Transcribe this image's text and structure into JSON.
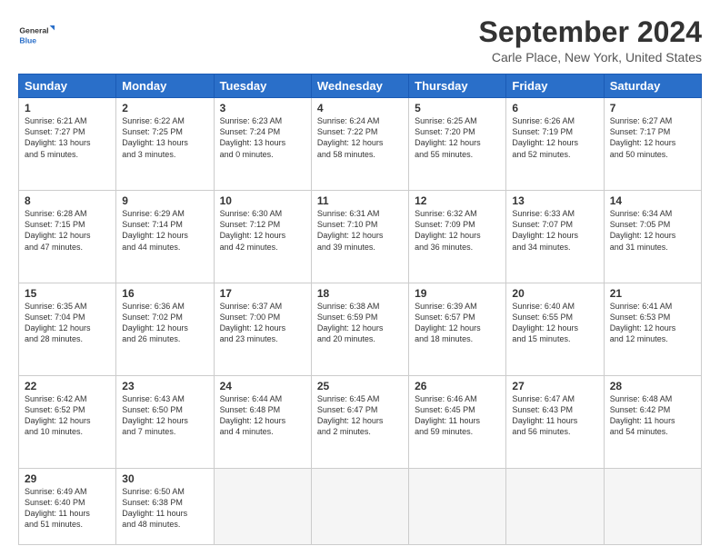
{
  "logo": {
    "line1": "General",
    "line2": "Blue"
  },
  "title": "September 2024",
  "subtitle": "Carle Place, New York, United States",
  "headers": [
    "Sunday",
    "Monday",
    "Tuesday",
    "Wednesday",
    "Thursday",
    "Friday",
    "Saturday"
  ],
  "weeks": [
    [
      {
        "day": "1",
        "info": "Sunrise: 6:21 AM\nSunset: 7:27 PM\nDaylight: 13 hours\nand 5 minutes."
      },
      {
        "day": "2",
        "info": "Sunrise: 6:22 AM\nSunset: 7:25 PM\nDaylight: 13 hours\nand 3 minutes."
      },
      {
        "day": "3",
        "info": "Sunrise: 6:23 AM\nSunset: 7:24 PM\nDaylight: 13 hours\nand 0 minutes."
      },
      {
        "day": "4",
        "info": "Sunrise: 6:24 AM\nSunset: 7:22 PM\nDaylight: 12 hours\nand 58 minutes."
      },
      {
        "day": "5",
        "info": "Sunrise: 6:25 AM\nSunset: 7:20 PM\nDaylight: 12 hours\nand 55 minutes."
      },
      {
        "day": "6",
        "info": "Sunrise: 6:26 AM\nSunset: 7:19 PM\nDaylight: 12 hours\nand 52 minutes."
      },
      {
        "day": "7",
        "info": "Sunrise: 6:27 AM\nSunset: 7:17 PM\nDaylight: 12 hours\nand 50 minutes."
      }
    ],
    [
      {
        "day": "8",
        "info": "Sunrise: 6:28 AM\nSunset: 7:15 PM\nDaylight: 12 hours\nand 47 minutes."
      },
      {
        "day": "9",
        "info": "Sunrise: 6:29 AM\nSunset: 7:14 PM\nDaylight: 12 hours\nand 44 minutes."
      },
      {
        "day": "10",
        "info": "Sunrise: 6:30 AM\nSunset: 7:12 PM\nDaylight: 12 hours\nand 42 minutes."
      },
      {
        "day": "11",
        "info": "Sunrise: 6:31 AM\nSunset: 7:10 PM\nDaylight: 12 hours\nand 39 minutes."
      },
      {
        "day": "12",
        "info": "Sunrise: 6:32 AM\nSunset: 7:09 PM\nDaylight: 12 hours\nand 36 minutes."
      },
      {
        "day": "13",
        "info": "Sunrise: 6:33 AM\nSunset: 7:07 PM\nDaylight: 12 hours\nand 34 minutes."
      },
      {
        "day": "14",
        "info": "Sunrise: 6:34 AM\nSunset: 7:05 PM\nDaylight: 12 hours\nand 31 minutes."
      }
    ],
    [
      {
        "day": "15",
        "info": "Sunrise: 6:35 AM\nSunset: 7:04 PM\nDaylight: 12 hours\nand 28 minutes."
      },
      {
        "day": "16",
        "info": "Sunrise: 6:36 AM\nSunset: 7:02 PM\nDaylight: 12 hours\nand 26 minutes."
      },
      {
        "day": "17",
        "info": "Sunrise: 6:37 AM\nSunset: 7:00 PM\nDaylight: 12 hours\nand 23 minutes."
      },
      {
        "day": "18",
        "info": "Sunrise: 6:38 AM\nSunset: 6:59 PM\nDaylight: 12 hours\nand 20 minutes."
      },
      {
        "day": "19",
        "info": "Sunrise: 6:39 AM\nSunset: 6:57 PM\nDaylight: 12 hours\nand 18 minutes."
      },
      {
        "day": "20",
        "info": "Sunrise: 6:40 AM\nSunset: 6:55 PM\nDaylight: 12 hours\nand 15 minutes."
      },
      {
        "day": "21",
        "info": "Sunrise: 6:41 AM\nSunset: 6:53 PM\nDaylight: 12 hours\nand 12 minutes."
      }
    ],
    [
      {
        "day": "22",
        "info": "Sunrise: 6:42 AM\nSunset: 6:52 PM\nDaylight: 12 hours\nand 10 minutes."
      },
      {
        "day": "23",
        "info": "Sunrise: 6:43 AM\nSunset: 6:50 PM\nDaylight: 12 hours\nand 7 minutes."
      },
      {
        "day": "24",
        "info": "Sunrise: 6:44 AM\nSunset: 6:48 PM\nDaylight: 12 hours\nand 4 minutes."
      },
      {
        "day": "25",
        "info": "Sunrise: 6:45 AM\nSunset: 6:47 PM\nDaylight: 12 hours\nand 2 minutes."
      },
      {
        "day": "26",
        "info": "Sunrise: 6:46 AM\nSunset: 6:45 PM\nDaylight: 11 hours\nand 59 minutes."
      },
      {
        "day": "27",
        "info": "Sunrise: 6:47 AM\nSunset: 6:43 PM\nDaylight: 11 hours\nand 56 minutes."
      },
      {
        "day": "28",
        "info": "Sunrise: 6:48 AM\nSunset: 6:42 PM\nDaylight: 11 hours\nand 54 minutes."
      }
    ],
    [
      {
        "day": "29",
        "info": "Sunrise: 6:49 AM\nSunset: 6:40 PM\nDaylight: 11 hours\nand 51 minutes."
      },
      {
        "day": "30",
        "info": "Sunrise: 6:50 AM\nSunset: 6:38 PM\nDaylight: 11 hours\nand 48 minutes."
      },
      null,
      null,
      null,
      null,
      null
    ]
  ]
}
